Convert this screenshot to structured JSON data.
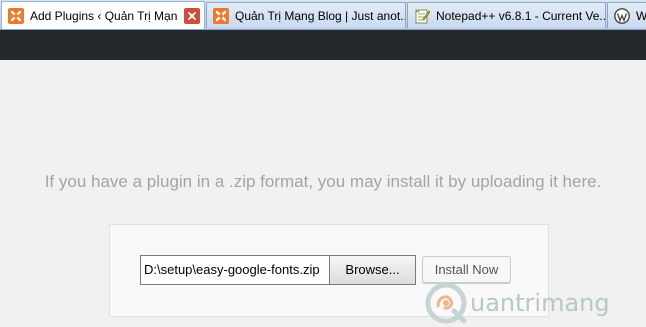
{
  "tabs": [
    {
      "title": "Add Plugins ‹ Quản Trị Mạn...",
      "icon": "xampp-icon",
      "active": true,
      "show_close": true
    },
    {
      "title": "Quản Trị Mạng Blog | Just anot...",
      "icon": "xampp-icon",
      "active": false
    },
    {
      "title": "Notepad++ v6.8.1 - Current Ve...",
      "icon": "notepad-icon",
      "active": false
    },
    {
      "title": "Wo",
      "icon": "wordpress-icon",
      "active": false
    }
  ],
  "upload": {
    "description": "If you have a plugin in a .zip format, you may install it by uploading it here.",
    "file_path": "D:\\setup\\easy-google-fonts.zip",
    "browse_label": "Browse...",
    "install_label": "Install Now"
  },
  "watermark": {
    "text": "uantrimang",
    "logo": "quantrimang-logo"
  },
  "colors": {
    "admin_bar": "#23282d",
    "page_background": "#f1f1f1",
    "description_text": "#a0a5aa",
    "xampp_orange": "#f0782a",
    "close_red": "#c94f3a"
  }
}
